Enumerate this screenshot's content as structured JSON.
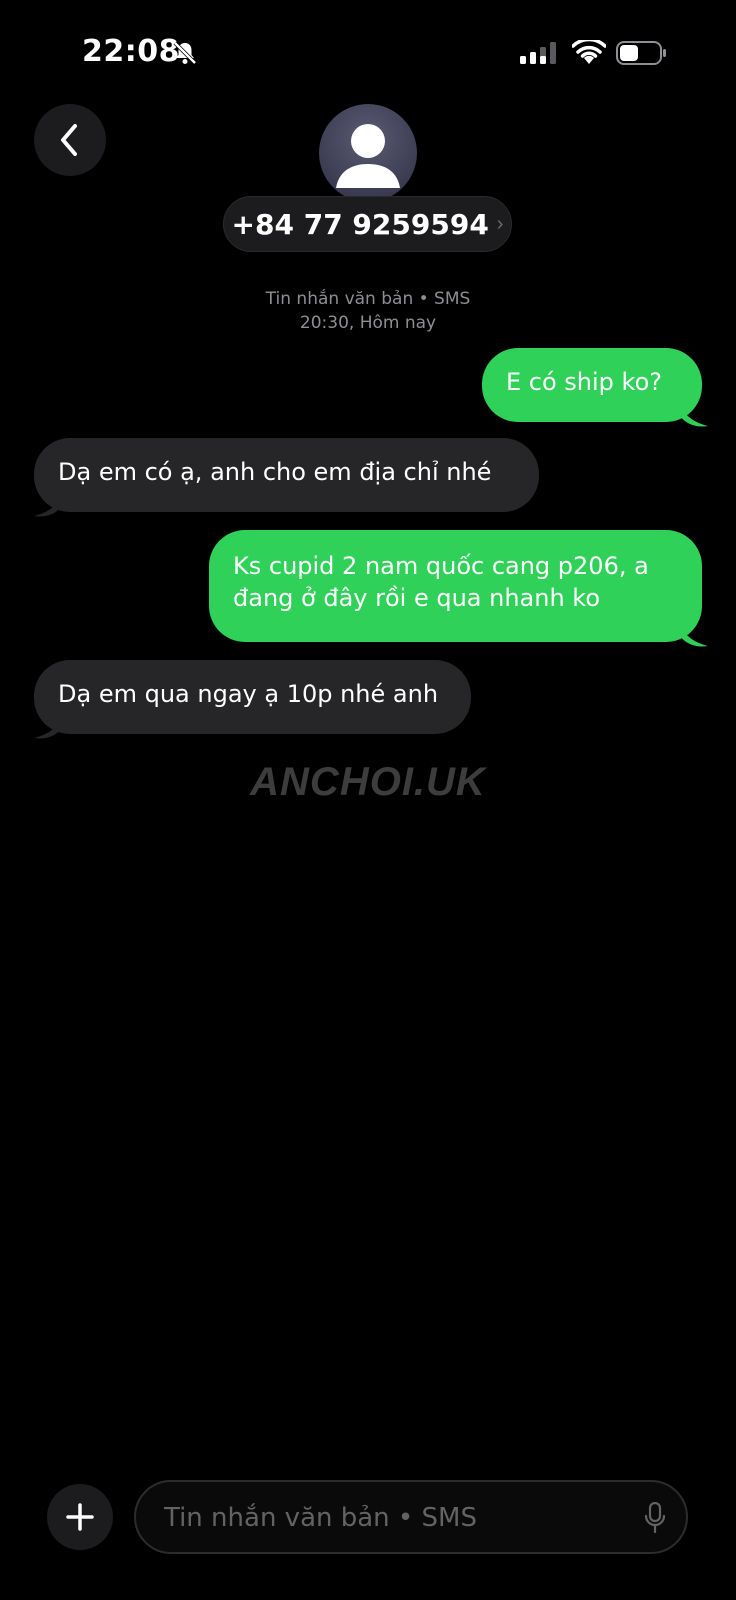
{
  "status_bar": {
    "time": "22:08",
    "icons": [
      "bell-slash-icon",
      "signal-icon",
      "wifi-icon",
      "battery-icon"
    ]
  },
  "header": {
    "back_icon": "chevron-left-icon",
    "avatar_icon": "person-icon",
    "contact": "+84 77 9259594",
    "contact_chevron": "›"
  },
  "thread_meta": {
    "line1": "Tin nhắn văn bản • SMS",
    "line2": "20:30, Hôm nay"
  },
  "messages": [
    {
      "direction": "sent",
      "text": "E có ship ko?"
    },
    {
      "direction": "received",
      "text": "Dạ em có ạ, anh cho em địa chỉ nhé"
    },
    {
      "direction": "sent",
      "text": "Ks cupid 2 nam quốc cang p206, a đang ở đây rồi e qua nhanh ko"
    },
    {
      "direction": "received",
      "text": "Dạ em qua ngay ạ 10p nhé anh"
    }
  ],
  "watermark": "ANCHOI.UK",
  "composer": {
    "placeholder": "Tin nhắn văn bản • SMS",
    "value": "",
    "add_icon": "plus-icon",
    "mic_icon": "microphone-icon"
  },
  "colors": {
    "sent_bubble": "#30d158",
    "received_bubble": "#262628",
    "background": "#000000"
  }
}
